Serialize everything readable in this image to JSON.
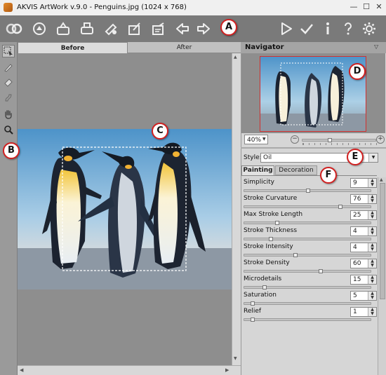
{
  "window": {
    "title": "AKVIS ArtWork v.9.0 - Penguins.jpg (1024 x 768)",
    "minimize": "—",
    "maximize": "☐",
    "close": "✕"
  },
  "toolbar": {
    "icons": [
      "open-image-icon",
      "open-file-icon",
      "save-icon",
      "print-icon",
      "share-icon",
      "batch-icon",
      "presets-icon",
      "back-arrow-icon",
      "forward-arrow-icon",
      "run-icon",
      "apply-icon",
      "info-icon",
      "help-icon",
      "settings-icon"
    ]
  },
  "callouts": {
    "a": "A",
    "b": "B",
    "c": "C",
    "d": "D",
    "e": "E",
    "f": "F"
  },
  "canvas": {
    "tabs": [
      {
        "label": "Before",
        "active": true
      },
      {
        "label": "After",
        "active": false
      }
    ]
  },
  "navigator": {
    "title": "Navigator",
    "zoom": "40%"
  },
  "settings": {
    "style_label": "Style:",
    "style_value": "Oil",
    "tabs": [
      {
        "label": "Painting",
        "active": true
      },
      {
        "label": "Decoration",
        "active": false
      }
    ],
    "params": [
      {
        "label": "Simplicity",
        "value": "9",
        "level": 0.5
      },
      {
        "label": "Stroke Curvature",
        "value": "76",
        "level": 0.76
      },
      {
        "label": "Max Stroke Length",
        "value": "25",
        "level": 0.25
      },
      {
        "label": "Stroke Thickness",
        "value": "4",
        "level": 0.2
      },
      {
        "label": "Stroke Intensity",
        "value": "4",
        "level": 0.4
      },
      {
        "label": "Stroke Density",
        "value": "60",
        "level": 0.6
      },
      {
        "label": "Microdetails",
        "value": "15",
        "level": 0.15
      },
      {
        "label": "Saturation",
        "value": "5",
        "level": 0.05
      },
      {
        "label": "Relief",
        "value": "1",
        "level": 0.05
      }
    ]
  }
}
